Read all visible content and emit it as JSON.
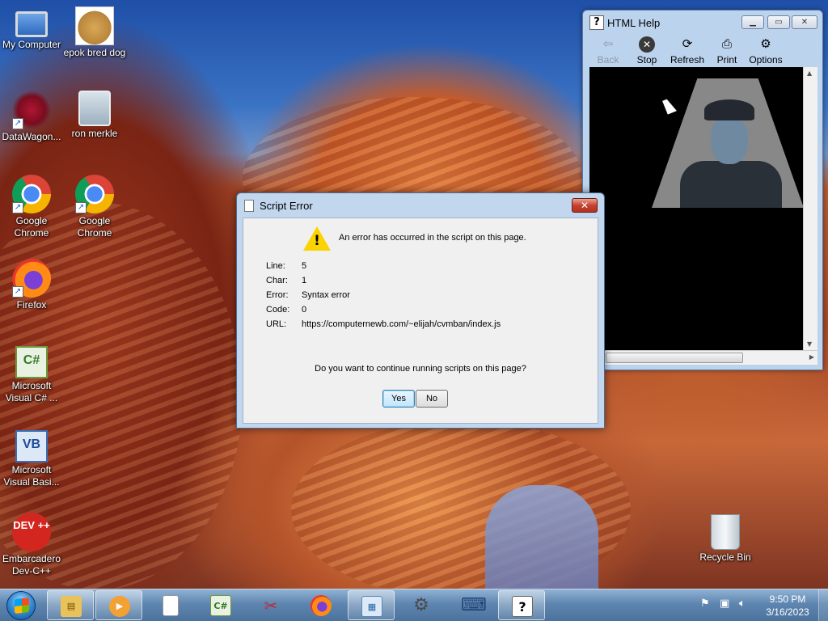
{
  "desktop": {
    "icons": [
      {
        "label": "My Computer",
        "icon": "computer-icon"
      },
      {
        "label": "epok bred dog",
        "icon": "image-icon"
      },
      {
        "label": "DataWagon...",
        "icon": "datawagon-icon"
      },
      {
        "label": "ron merkle",
        "icon": "user-icon"
      },
      {
        "label": "Google Chrome",
        "icon": "chrome-icon"
      },
      {
        "label": "Google Chrome",
        "icon": "chrome-icon"
      },
      {
        "label": "Firefox",
        "icon": "firefox-icon"
      },
      {
        "label": "Microsoft Visual C# ...",
        "icon": "csharp-icon",
        "glyph": "C#"
      },
      {
        "label": "Microsoft Visual Basi...",
        "icon": "vb-icon",
        "glyph": "VB"
      },
      {
        "label": "Embarcadero Dev-C++",
        "icon": "devcpp-icon",
        "glyph": "DEV ++"
      },
      {
        "label": "Recycle Bin",
        "icon": "recycle-bin-icon"
      }
    ]
  },
  "help_window": {
    "title": "HTML Help",
    "toolbar": {
      "back": "Back",
      "stop": "Stop",
      "refresh": "Refresh",
      "print": "Print",
      "options": "Options"
    }
  },
  "error_dialog": {
    "title": "Script Error",
    "headline": "An error has occurred in the script on this page.",
    "details": [
      {
        "label": "Line:",
        "value": "5"
      },
      {
        "label": "Char:",
        "value": "1"
      },
      {
        "label": "Error:",
        "value": "Syntax error"
      },
      {
        "label": "Code:",
        "value": "0"
      },
      {
        "label": "URL:",
        "value": "https://computernewb.com/~elijah/cvmban/index.js"
      }
    ],
    "question": "Do you want to continue running scripts on this page?",
    "yes_label": "Yes",
    "no_label": "No"
  },
  "taskbar": {
    "items": [
      {
        "icon": "file-explorer-icon",
        "glyph": "▤"
      },
      {
        "icon": "media-player-icon",
        "glyph": "▶"
      },
      {
        "icon": "document-icon",
        "glyph": ""
      },
      {
        "icon": "csharp-icon",
        "glyph": "C#"
      },
      {
        "icon": "snipping-tool-icon",
        "glyph": "✂"
      },
      {
        "icon": "firefox-icon",
        "glyph": ""
      },
      {
        "icon": "control-panel-icon",
        "glyph": "▦"
      },
      {
        "icon": "settings-gear-icon",
        "glyph": "⚙"
      },
      {
        "icon": "keyboard-icon",
        "glyph": "⌨"
      },
      {
        "icon": "html-help-icon",
        "glyph": "?"
      }
    ],
    "clock": {
      "time": "9:50 PM",
      "date": "3/16/2023"
    }
  }
}
